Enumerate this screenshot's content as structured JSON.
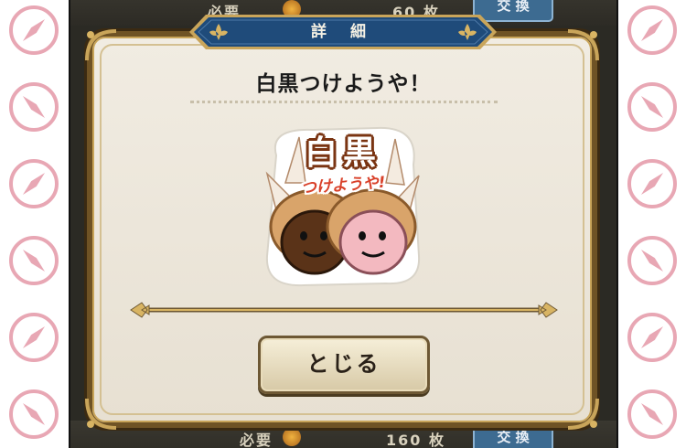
{
  "background": {
    "top_row": {
      "label": "必要",
      "count": "60 枚",
      "button": "交 換"
    },
    "bottom_row": {
      "label": "必要",
      "count": "160 枚",
      "button": "交 換"
    }
  },
  "dialog": {
    "title": "詳 細",
    "item_name": "白黒つけようや！",
    "sticker": {
      "headline": "白黒",
      "tagline": "つけようや!"
    },
    "close_label": "とじる"
  },
  "colors": {
    "frame": "#6f5325",
    "banner": "#1f4b7a",
    "panel": "#efe9dd",
    "compass": "#e8a7b4"
  },
  "icons": [
    "compass-icon",
    "fleur-de-lis-icon",
    "coin-icon"
  ]
}
